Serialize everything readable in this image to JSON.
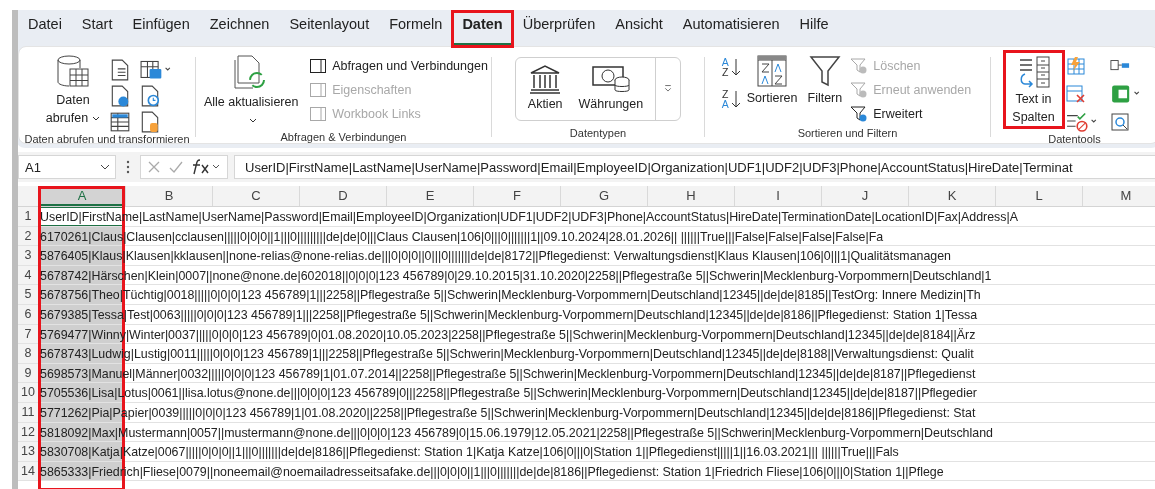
{
  "tabs": [
    {
      "label": "Datei",
      "selected": false,
      "highlighted": false
    },
    {
      "label": "Start",
      "selected": false,
      "highlighted": false
    },
    {
      "label": "Einfügen",
      "selected": false,
      "highlighted": false
    },
    {
      "label": "Zeichnen",
      "selected": false,
      "highlighted": false
    },
    {
      "label": "Seitenlayout",
      "selected": false,
      "highlighted": false
    },
    {
      "label": "Formeln",
      "selected": false,
      "highlighted": false
    },
    {
      "label": "Daten",
      "selected": true,
      "highlighted": true
    },
    {
      "label": "Überprüfen",
      "selected": false,
      "highlighted": false
    },
    {
      "label": "Ansicht",
      "selected": false,
      "highlighted": false
    },
    {
      "label": "Automatisieren",
      "selected": false,
      "highlighted": false
    },
    {
      "label": "Hilfe",
      "selected": false,
      "highlighted": false
    }
  ],
  "ribbon": {
    "groups": [
      {
        "label": "Daten abrufen und transformieren",
        "large": [
          {
            "label": "Daten abrufen",
            "dropdown": true,
            "highlighted": false
          }
        ]
      },
      {
        "label": "Abfragen & Verbindungen",
        "large": [
          {
            "label": "Alle aktualisieren",
            "dropdown": true,
            "highlighted": false
          }
        ],
        "small": [
          {
            "label": "Abfragen und Verbindungen",
            "disabled": false
          },
          {
            "label": "Eigenschaften",
            "disabled": true
          },
          {
            "label": "Workbook Links",
            "disabled": true
          }
        ]
      },
      {
        "label": "Datentypen",
        "large": [
          {
            "label": "Aktien",
            "dropdown": false,
            "highlighted": false
          },
          {
            "label": "Währungen",
            "dropdown": false,
            "highlighted": false
          }
        ]
      },
      {
        "label": "Sortieren und Filtern",
        "sort_icons": [
          {
            "top": "A",
            "bottom": "Z"
          },
          {
            "top": "Z",
            "bottom": "A"
          }
        ],
        "large": [
          {
            "label": "Sortieren",
            "dropdown": false,
            "highlighted": false
          },
          {
            "label": "Filtern",
            "dropdown": false,
            "highlighted": false
          }
        ],
        "small": [
          {
            "label": "Löschen",
            "disabled": true
          },
          {
            "label": "Erneut anwenden",
            "disabled": true
          },
          {
            "label": "Erweitert",
            "disabled": false
          }
        ]
      },
      {
        "label": "Datentools",
        "large": [
          {
            "label": "Text in Spalten",
            "dropdown": false,
            "highlighted": true
          }
        ]
      }
    ]
  },
  "formula_bar": {
    "name_box": "A1",
    "formula": "UserID|FirstName|LastName|UserName|Password|Email|EmployeeID|Organization|UDF1|UDF2|UDF3|Phone|AccountStatus|HireDate|Terminat"
  },
  "columns": [
    {
      "label": "A",
      "selected": true,
      "highlighted": true
    },
    {
      "label": "B",
      "selected": false,
      "highlighted": false
    },
    {
      "label": "C",
      "selected": false,
      "highlighted": false
    },
    {
      "label": "D",
      "selected": false,
      "highlighted": false
    },
    {
      "label": "E",
      "selected": false,
      "highlighted": false
    },
    {
      "label": "F",
      "selected": false,
      "highlighted": false
    },
    {
      "label": "G",
      "selected": false,
      "highlighted": false
    },
    {
      "label": "H",
      "selected": false,
      "highlighted": false
    },
    {
      "label": "I",
      "selected": false,
      "highlighted": false
    },
    {
      "label": "J",
      "selected": false,
      "highlighted": false
    },
    {
      "label": "K",
      "selected": false,
      "highlighted": false
    },
    {
      "label": "L",
      "selected": false,
      "highlighted": false
    },
    {
      "label": "M",
      "selected": false,
      "highlighted": false
    }
  ],
  "rows": [
    {
      "number": "1",
      "active": true,
      "text": "UserID|FirstName|LastName|UserName|Password|Email|EmployeeID|Organization|UDF1|UDF2|UDF3|Phone|AccountStatus|HireDate|TerminationDate|LocationID|Fax|Address|A"
    },
    {
      "number": "2",
      "active": false,
      "text": "6170261|Claus|Clausen|cclausen|||||0|0|0||1|||0|||||||||de|de|0|||Claus Clausen|106|0|||0|||||||1||09.10.2024|28.01.2026|| ||||||True|||False|False|False|False|Fa"
    },
    {
      "number": "3",
      "active": false,
      "text": "5876405|Klaus|Klausen|kklausen||none-relias@none-relias.de|||0|0|0||0|||0|||||||de|de|8172||Pflegedienst: Verwaltungsdienst|Klaus Klausen|106|0|||1|Qualitätsmanagen"
    },
    {
      "number": "4",
      "active": false,
      "text": "5678742|Härschen|Klein|0007||none@none.de|602018||0|0|0|123 456789|0|29.10.2015|31.10.2020|2258||Pflegestraße 5||Schwerin|Mecklenburg-Vorpommern|Deutschland|1"
    },
    {
      "number": "5",
      "active": false,
      "text": "5678756|Theo|Tüchtig|0018|||||0|0|0|123 456789|1|||2258||Pflegestraße 5||Schwerin|Mecklenburg-Vorpommern|Deutschland|12345||de|de|8185||TestOrg: Innere Medizin|Th"
    },
    {
      "number": "6",
      "active": false,
      "text": "5679385|Tessa|Test|0063|||||0|0|0|123 456789|1|||2258||Pflegestraße 5||Schwerin|Mecklenburg-Vorpommern|Deutschland|12345||de|de|8186||Pflegedienst: Station 1|Tessa"
    },
    {
      "number": "7",
      "active": false,
      "text": "5769477|Winny|Winter|0037|||||0|0|0|123 456789|0|01.08.2020|10.05.2023|2258||Pflegestraße 5||Schwerin|Mecklenburg-Vorpommern|Deutschland|12345||de|de|8184||Ärz"
    },
    {
      "number": "8",
      "active": false,
      "text": "5678743|Ludwig|Lustig|0011|||||0|0|0|123 456789|1|||2258||Pflegestraße 5||Schwerin|Mecklenburg-Vorpommern|Deutschland|12345||de|de|8188||Verwaltungsdienst: Qualit"
    },
    {
      "number": "9",
      "active": false,
      "text": "5698573|Manuel|Männer|0032|||||0|0|0|123 456789|1|01.07.2014||2258||Pflegestraße 5||Schwerin|Mecklenburg-Vorpommern|Deutschland|12345||de|de|8187||Pflegedienst"
    },
    {
      "number": "10",
      "active": false,
      "text": "5705536|Lisa|Lotus|0061||lisa.lotus@none.de|||0|0|0|123 456789|0|||2258||Pflegestraße 5||Schwerin|Mecklenburg-Vorpommern|Deutschland|12345||de|de|8187||Pflegedier"
    },
    {
      "number": "11",
      "active": false,
      "text": "5771262|Pia|Papier|0039|||||0|0|0|123 456789|1|01.08.2020||2258||Pflegestraße 5||Schwerin|Mecklenburg-Vorpommern|Deutschland|12345||de|de|8186||Pflegedienst: Stat"
    },
    {
      "number": "12",
      "active": false,
      "text": "5818092|Max|Mustermann|0057||mustermann@none.de|||0|0|0|123 456789|0|15.06.1979|12.05.2021|2258||Pflegestraße 5||Schwerin|Mecklenburg-Vorpommern|Deutschland"
    },
    {
      "number": "13",
      "active": false,
      "text": "5830708|Katja|Katze|0067|||||0|0|0||1|||0|||||||de|de|8186||Pflegedienst: Station 1|Katja Katze|106|0|||0|Station 1||Pflegedienst|||||1||16.03.2021||| ||||||True|||Fals"
    },
    {
      "number": "14",
      "active": false,
      "text": "5865333|Friedrich|Fliese|0079||noneemail@noemailadresseitsafake.de|||0|0|0||1|||0|||||||de|de|8186||Pflegedienst: Station 1|Friedrich Fliese|106|0|||0|Station 1||Pflege"
    }
  ]
}
